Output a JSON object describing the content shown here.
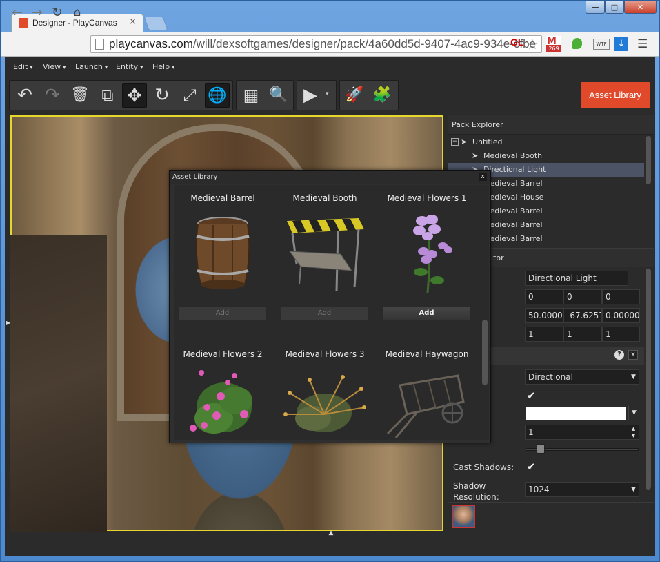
{
  "window": {
    "tab_title": "Designer - PlayCanvas",
    "tab_close": "×",
    "controls": {
      "minimize": "—",
      "maximize": "□",
      "close": "✕"
    }
  },
  "browser": {
    "url_host": "playcanvas.com",
    "url_path": "/will/dexsoftgames/designer/pack/4a60dd5d-9407-4ac9-934e-cfbe",
    "gl_badge": "GL",
    "gmail_count": "269",
    "ext_wtf": "WTF"
  },
  "menu": [
    "Edit",
    "View",
    "Launch",
    "Entity",
    "Help"
  ],
  "toolbar": {
    "asset_library_label": "Asset Library"
  },
  "pack_explorer": {
    "title": "Pack Explorer",
    "items": [
      {
        "label": "Untitled",
        "depth": 0,
        "selected": false
      },
      {
        "label": "Medieval Booth",
        "depth": 1,
        "selected": false
      },
      {
        "label": "Directional Light",
        "depth": 1,
        "selected": true
      },
      {
        "label": "Medieval Barrel",
        "depth": 1,
        "selected": false
      },
      {
        "label": "Medieval House",
        "depth": 1,
        "selected": false
      },
      {
        "label": "Medieval Barrel",
        "depth": 1,
        "selected": false
      },
      {
        "label": "Medieval Barrel",
        "depth": 1,
        "selected": false
      },
      {
        "label": "Medieval Barrel",
        "depth": 1,
        "selected": false
      }
    ]
  },
  "entity_editor": {
    "title_fragment": "ditor",
    "name": "Directional Light",
    "position": [
      "0",
      "0",
      "0"
    ],
    "rotation": [
      "50.00000",
      "-67.6257",
      "0.000001"
    ],
    "scale": [
      "1",
      "1",
      "1"
    ],
    "light": {
      "type": "Directional",
      "enabled": true,
      "color": "#ffffff",
      "intensity": "1",
      "intensity_slider": 0.1,
      "cast_shadows_label": "Cast Shadows:",
      "cast_shadows": true,
      "shadow_resolution_label": "Shadow Resolution:",
      "shadow_resolution": "1024"
    }
  },
  "asset_library": {
    "title": "Asset Library",
    "close": "x",
    "assets": [
      {
        "name": "Medieval Barrel",
        "add_label": "Add",
        "enabled": false
      },
      {
        "name": "Medieval Booth",
        "add_label": "Add",
        "enabled": false
      },
      {
        "name": "Medieval Flowers 1",
        "add_label": "Add",
        "enabled": true
      },
      {
        "name": "Medieval Flowers 2"
      },
      {
        "name": "Medieval Flowers 3"
      },
      {
        "name": "Medieval Haywagon"
      }
    ]
  },
  "colors": {
    "accent": "#e0492a",
    "selection": "#4b5364",
    "viewport_border": "#e5d72e"
  }
}
